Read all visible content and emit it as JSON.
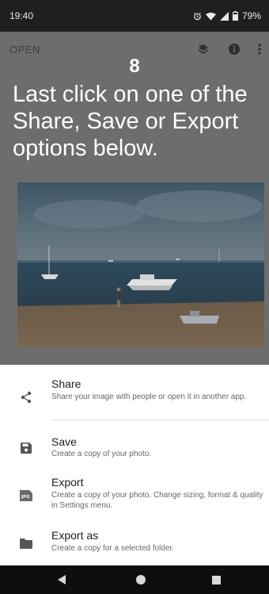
{
  "status_bar": {
    "time": "19:40",
    "battery": "79%",
    "icons": [
      "alarm-icon",
      "wifi-icon",
      "signal-icon",
      "battery-icon"
    ]
  },
  "toolbar": {
    "open_label": "OPEN",
    "icons": [
      "layers-undo-icon",
      "info-icon",
      "more-vert-icon"
    ]
  },
  "overlay": {
    "step_number": "8",
    "instruction": "Last click on one of the Share, Save or  Export options below."
  },
  "sheet": {
    "items": [
      {
        "icon": "share-icon",
        "title": "Share",
        "description": "Share your image with people or open it in another app."
      },
      {
        "icon": "save-icon",
        "title": "Save",
        "description": "Create a copy of your photo."
      },
      {
        "icon": "jpg-export-icon",
        "title": "Export",
        "description": "Create a copy of your photo. Change sizing, format & quality in Settings menu."
      },
      {
        "icon": "folder-icon",
        "title": "Export as",
        "description": "Create a copy for a selected folder."
      }
    ]
  },
  "nav_bar": {
    "buttons": [
      "back-icon",
      "home-icon",
      "recents-icon"
    ]
  },
  "colors": {
    "overlay_gray": "#6d6d6d",
    "status_bar": "#1f1f1f",
    "nav_bar": "#0e0e0e",
    "sheet_bg": "#ffffff"
  }
}
